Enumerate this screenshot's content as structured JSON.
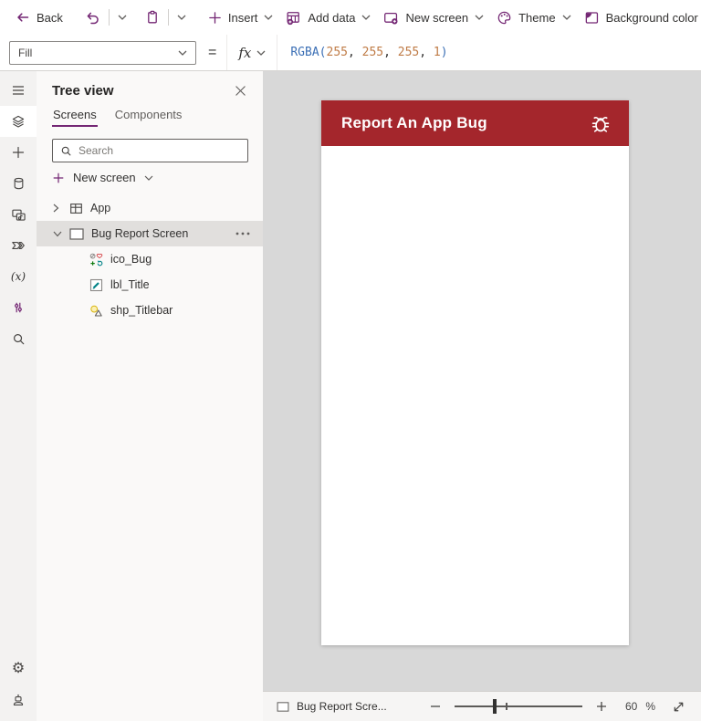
{
  "colors": {
    "accent_purple": "#742774",
    "app_titlebar_red": "#a4262c",
    "formula_function_blue": "#3b6fb5",
    "formula_number_orange": "#bf7b46",
    "canvas_gray": "#d8d8d8"
  },
  "toolbar": {
    "back_label": "Back",
    "insert_label": "Insert",
    "add_data_label": "Add data",
    "new_screen_label": "New screen",
    "theme_label": "Theme",
    "background_color_label": "Background color",
    "icons": [
      "back-arrow-icon",
      "undo-icon",
      "clipboard-paste-icon",
      "plus-icon",
      "add-data-table-icon",
      "new-screen-icon",
      "theme-palette-icon",
      "background-color-icon"
    ]
  },
  "formula_bar": {
    "property_selected": "Fill",
    "equals_sign": "=",
    "fx_label": "fx",
    "formula": {
      "fn_open": "RGBA(",
      "n1": "255",
      "sep1": ", ",
      "n2": "255",
      "sep2": ", ",
      "n3": "255",
      "sep3": ", ",
      "n4": "1",
      "close": ")"
    }
  },
  "rail": {
    "icons": [
      "hamburger-menu-icon",
      "tree-view-layers-icon",
      "insert-plus-icon",
      "data-cylinder-icon",
      "media-icon",
      "power-automate-icon",
      "variables-icon",
      "advanced-tools-icon",
      "search-icon",
      "settings-gear-icon",
      "virtual-agent-bot-icon"
    ],
    "variables_glyph": "(x)",
    "settings_glyph": "⚙"
  },
  "tree_panel": {
    "title": "Tree view",
    "tabs": [
      {
        "label": "Screens",
        "active": true
      },
      {
        "label": "Components",
        "active": false
      }
    ],
    "search_placeholder": "Search",
    "new_screen_label": "New screen",
    "app_item": {
      "label": "App"
    },
    "screen_item": {
      "label": "Bug Report Screen",
      "selected": true,
      "children": [
        {
          "label": "ico_Bug",
          "icon": "icon-control-icon"
        },
        {
          "label": "lbl_Title",
          "icon": "label-control-icon"
        },
        {
          "label": "shp_Titlebar",
          "icon": "shape-control-icon"
        }
      ]
    }
  },
  "canvas": {
    "preview": {
      "title": "Report An App Bug",
      "titlebar_icon": "bug-icon"
    }
  },
  "status_bar": {
    "breadcrumb": "Bug Report Scre...",
    "zoom_value": "60",
    "zoom_unit": "%",
    "slider_handle_percent": 30,
    "slider_notch_percent": 40
  }
}
